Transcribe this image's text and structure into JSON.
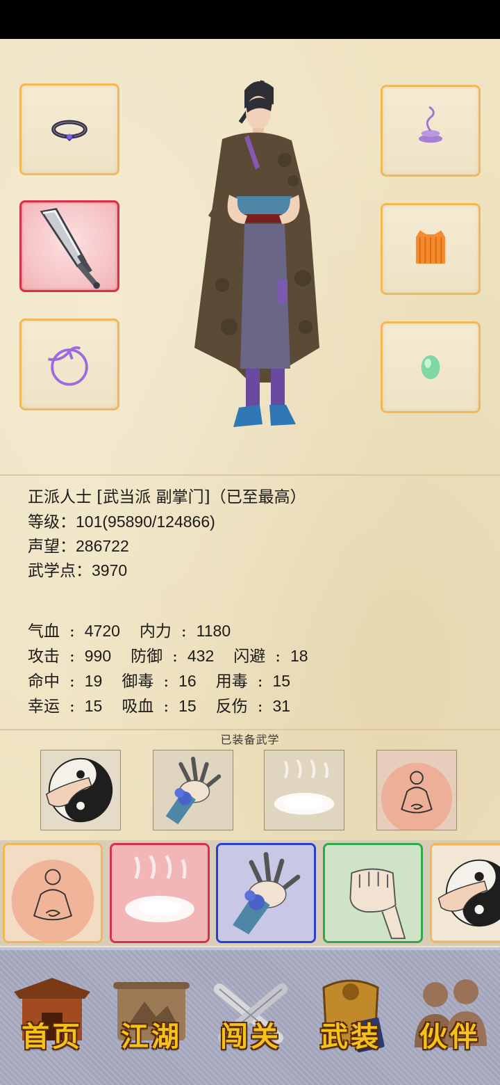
{
  "colors": {
    "slot_border": "#f2b857",
    "slot_active_border": "#d8304a",
    "nav_bg": "#a9abc2",
    "nav_label": "#f4c21b"
  },
  "equipment": {
    "left": [
      {
        "icon": "ring-icon",
        "selected": false
      },
      {
        "icon": "saber-icon",
        "selected": true
      },
      {
        "icon": "string-pendant-icon",
        "selected": false
      }
    ],
    "right": [
      {
        "icon": "incense-smoke-icon",
        "selected": false
      },
      {
        "icon": "armor-vest-icon",
        "selected": false
      },
      {
        "icon": "jade-stone-icon",
        "selected": false
      }
    ]
  },
  "character": {
    "title": "正派人士 [武当派 副掌门]（已至最高）",
    "level_label": "等级：",
    "level_value": "101(95890/124866)",
    "reputation_label": "声望：",
    "reputation_value": "286722",
    "martial_points_label": "武学点：",
    "martial_points_value": "3970"
  },
  "stats": {
    "rows": [
      [
        {
          "label": "气血",
          "value": "4720"
        },
        {
          "label": "内力",
          "value": "1180"
        }
      ],
      [
        {
          "label": "攻击",
          "value": "990"
        },
        {
          "label": "防御",
          "value": "432"
        },
        {
          "label": "闪避",
          "value": "18"
        }
      ],
      [
        {
          "label": "命中",
          "value": "19"
        },
        {
          "label": "御毒",
          "value": "16"
        },
        {
          "label": "用毒",
          "value": "15"
        }
      ],
      [
        {
          "label": "幸运",
          "value": "15"
        },
        {
          "label": "吸血",
          "value": "15"
        },
        {
          "label": "反伤",
          "value": "31"
        }
      ]
    ]
  },
  "equipped_skills_caption": "已装备武学",
  "equipped_skills": [
    {
      "icon": "taiji-palm-icon"
    },
    {
      "icon": "flower-hand-icon"
    },
    {
      "icon": "cloud-mist-icon"
    },
    {
      "icon": "meditation-icon"
    }
  ],
  "skill_pool": [
    {
      "icon": "meditation-icon",
      "color": "#f2b857"
    },
    {
      "icon": "cloud-mist-icon",
      "color": "#d8304a"
    },
    {
      "icon": "flower-hand-icon",
      "color": "#2a3fd0"
    },
    {
      "icon": "fist-icon",
      "color": "#2ea84a"
    },
    {
      "icon": "taiji-palm-icon",
      "color": "#f2b857"
    }
  ],
  "nav": [
    {
      "label": "首页",
      "icon": "temple-icon"
    },
    {
      "label": "江湖",
      "icon": "scroll-map-icon"
    },
    {
      "label": "闯关",
      "icon": "crossed-swords-icon"
    },
    {
      "label": "武装",
      "icon": "armor-book-icon"
    },
    {
      "label": "伙伴",
      "icon": "companions-icon"
    }
  ]
}
